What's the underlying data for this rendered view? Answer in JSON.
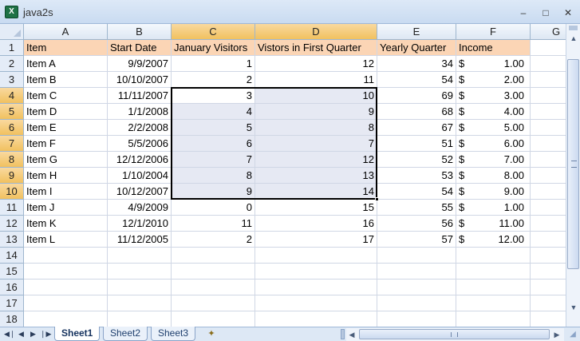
{
  "window": {
    "title": "java2s",
    "icon": "excel-icon",
    "minimize_glyph": "–",
    "maximize_glyph": "□",
    "close_glyph": "✕"
  },
  "sheet": {
    "columns": [
      "A",
      "B",
      "C",
      "D",
      "E",
      "F",
      "G"
    ],
    "rows": [
      "1",
      "2",
      "3",
      "4",
      "5",
      "6",
      "7",
      "8",
      "9",
      "10",
      "11",
      "12",
      "13",
      "14",
      "15",
      "16",
      "17",
      "18"
    ],
    "header_row": [
      "Item",
      "Start Date",
      "January Visitors",
      "Vistors in First Quarter",
      "Yearly Quarter",
      "Income",
      ""
    ],
    "currency_symbol": "$",
    "data": [
      [
        "Item A",
        "9/9/2007",
        "1",
        "12",
        "34",
        "1.00"
      ],
      [
        "Item B",
        "10/10/2007",
        "2",
        "11",
        "54",
        "2.00"
      ],
      [
        "Item C",
        "11/11/2007",
        "3",
        "10",
        "69",
        "3.00"
      ],
      [
        "Item D",
        "1/1/2008",
        "4",
        "9",
        "68",
        "4.00"
      ],
      [
        "Item E",
        "2/2/2008",
        "5",
        "8",
        "67",
        "5.00"
      ],
      [
        "Item F",
        "5/5/2006",
        "6",
        "7",
        "51",
        "6.00"
      ],
      [
        "Item G",
        "12/12/2006",
        "7",
        "12",
        "52",
        "7.00"
      ],
      [
        "Item H",
        "1/10/2004",
        "8",
        "13",
        "53",
        "8.00"
      ],
      [
        "Item I",
        "10/12/2007",
        "9",
        "14",
        "54",
        "9.00"
      ],
      [
        "Item J",
        "4/9/2009",
        "0",
        "15",
        "55",
        "1.00"
      ],
      [
        "Item K",
        "12/1/2010",
        "11",
        "16",
        "56",
        "11.00"
      ],
      [
        "Item L",
        "11/12/2005",
        "2",
        "17",
        "57",
        "12.00"
      ]
    ],
    "selected_range": "C4:D10",
    "header_fill": "#fbd5b5",
    "selection_fill": "#e6e9f3",
    "header_highlight": "#f4c56a"
  },
  "tabs": {
    "items": [
      "Sheet1",
      "Sheet2",
      "Sheet3"
    ],
    "active": "Sheet1",
    "nav_first": "◀❘",
    "nav_prev": "◀",
    "nav_next": "▶",
    "nav_last": "❘▶"
  }
}
